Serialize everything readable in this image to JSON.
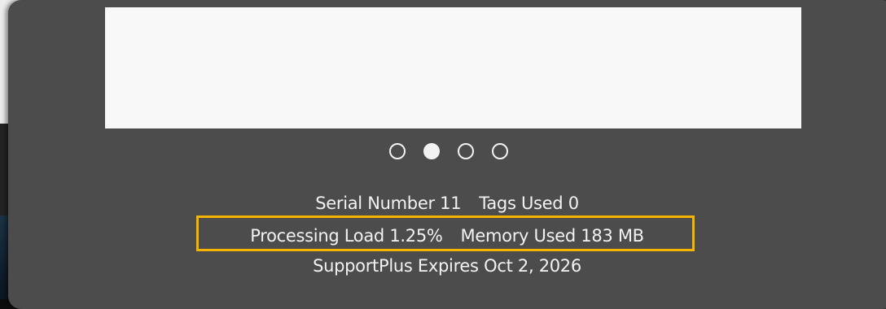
{
  "carousel": {
    "page_count": 4,
    "active_index": 1
  },
  "device_info": {
    "serial_number_label": "Serial Number",
    "serial_number_value": "11",
    "tags_used_label": "Tags Used",
    "tags_used_value": "0",
    "processing_load_label": "Processing Load",
    "processing_load_value": "1.25%",
    "memory_used_label": "Memory Used",
    "memory_used_value": "183 MB",
    "support_label": "SupportPlus Expires",
    "support_value": "Oct 2, 2026"
  },
  "colors": {
    "panel_background": "#4c4c4c",
    "preview_background": "#f8f8f8",
    "text": "#f2f2f2",
    "highlight_border": "#f5b400"
  }
}
